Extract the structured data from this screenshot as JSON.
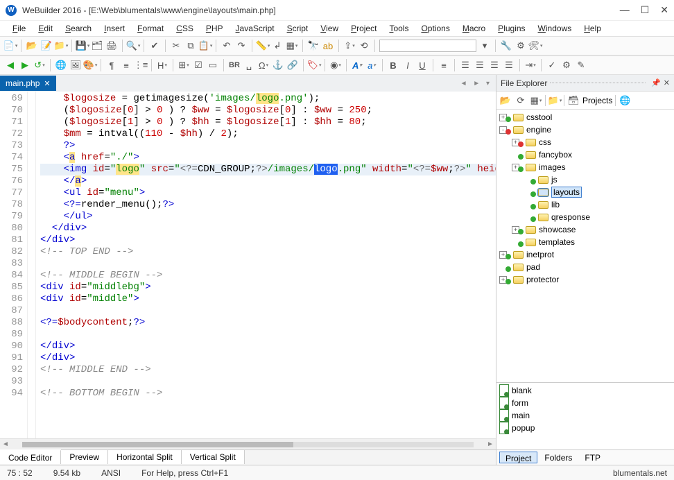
{
  "window": {
    "title": "WeBuilder 2016 - [E:\\Web\\blumentals\\www\\engine\\layouts\\main.php]",
    "app_initial": "W"
  },
  "menu": [
    "File",
    "Edit",
    "Search",
    "Insert",
    "Format",
    "CSS",
    "PHP",
    "JavaScript",
    "Script",
    "View",
    "Project",
    "Tools",
    "Options",
    "Macro",
    "Plugins",
    "Windows",
    "Help"
  ],
  "tabs": {
    "file": "main.php"
  },
  "code": {
    "start": 69,
    "lines": [
      {
        "n": 69,
        "seg": [
          {
            "t": "    ",
            "c": ""
          },
          {
            "t": "$logosize",
            "c": "c-var"
          },
          {
            "t": " = getimagesize(",
            "c": ""
          },
          {
            "t": "'images/",
            "c": "c-str"
          },
          {
            "t": "logo",
            "c": "c-str hl-y"
          },
          {
            "t": ".png'",
            "c": "c-str"
          },
          {
            "t": ");",
            "c": ""
          }
        ]
      },
      {
        "n": 70,
        "seg": [
          {
            "t": "    (",
            "c": ""
          },
          {
            "t": "$logosize",
            "c": "c-var"
          },
          {
            "t": "[",
            "c": ""
          },
          {
            "t": "0",
            "c": "c-num"
          },
          {
            "t": "] > ",
            "c": ""
          },
          {
            "t": "0",
            "c": "c-num"
          },
          {
            "t": " ) ? ",
            "c": ""
          },
          {
            "t": "$ww",
            "c": "c-var"
          },
          {
            "t": " = ",
            "c": ""
          },
          {
            "t": "$logosize",
            "c": "c-var"
          },
          {
            "t": "[",
            "c": ""
          },
          {
            "t": "0",
            "c": "c-num"
          },
          {
            "t": "] : ",
            "c": ""
          },
          {
            "t": "$ww",
            "c": "c-var"
          },
          {
            "t": " = ",
            "c": ""
          },
          {
            "t": "250",
            "c": "c-num"
          },
          {
            "t": ";",
            "c": ""
          }
        ]
      },
      {
        "n": 71,
        "seg": [
          {
            "t": "    (",
            "c": ""
          },
          {
            "t": "$logosize",
            "c": "c-var"
          },
          {
            "t": "[",
            "c": ""
          },
          {
            "t": "1",
            "c": "c-num"
          },
          {
            "t": "] > ",
            "c": ""
          },
          {
            "t": "0",
            "c": "c-num"
          },
          {
            "t": " ) ? ",
            "c": ""
          },
          {
            "t": "$hh",
            "c": "c-var"
          },
          {
            "t": " = ",
            "c": ""
          },
          {
            "t": "$logosize",
            "c": "c-var"
          },
          {
            "t": "[",
            "c": ""
          },
          {
            "t": "1",
            "c": "c-num"
          },
          {
            "t": "] : ",
            "c": ""
          },
          {
            "t": "$hh",
            "c": "c-var"
          },
          {
            "t": " = ",
            "c": ""
          },
          {
            "t": "80",
            "c": "c-num"
          },
          {
            "t": ";",
            "c": ""
          }
        ]
      },
      {
        "n": 72,
        "seg": [
          {
            "t": "    ",
            "c": ""
          },
          {
            "t": "$mm",
            "c": "c-var"
          },
          {
            "t": " = intval((",
            "c": ""
          },
          {
            "t": "110",
            "c": "c-num"
          },
          {
            "t": " - ",
            "c": ""
          },
          {
            "t": "$hh",
            "c": "c-var"
          },
          {
            "t": ") / ",
            "c": ""
          },
          {
            "t": "2",
            "c": "c-num"
          },
          {
            "t": ");",
            "c": ""
          }
        ]
      },
      {
        "n": 73,
        "seg": [
          {
            "t": "    ",
            "c": ""
          },
          {
            "t": "?>",
            "c": "c-kw"
          }
        ]
      },
      {
        "n": 74,
        "seg": [
          {
            "t": "    <",
            "c": "c-tag"
          },
          {
            "t": "a",
            "c": "c-tag hl-y"
          },
          {
            "t": " ",
            "c": ""
          },
          {
            "t": "href",
            "c": "c-attr"
          },
          {
            "t": "=",
            "c": ""
          },
          {
            "t": "\"./\"",
            "c": "c-str"
          },
          {
            "t": ">",
            "c": "c-tag"
          }
        ]
      },
      {
        "n": 75,
        "hl": true,
        "seg": [
          {
            "t": "    <",
            "c": "c-tag"
          },
          {
            "t": "img",
            "c": "c-tag"
          },
          {
            "t": " ",
            "c": ""
          },
          {
            "t": "id",
            "c": "c-attr"
          },
          {
            "t": "=",
            "c": ""
          },
          {
            "t": "\"",
            "c": "c-str"
          },
          {
            "t": "logo",
            "c": "c-str hl-y"
          },
          {
            "t": "\"",
            "c": "c-str"
          },
          {
            "t": " ",
            "c": ""
          },
          {
            "t": "src",
            "c": "c-attr"
          },
          {
            "t": "=",
            "c": ""
          },
          {
            "t": "\"",
            "c": "c-str"
          },
          {
            "t": "<?=",
            "c": "c-php"
          },
          {
            "t": "CDN_GROUP",
            "c": ""
          },
          {
            "t": ";",
            "c": ""
          },
          {
            "t": "?>",
            "c": "c-php"
          },
          {
            "t": "/images/",
            "c": "c-str"
          },
          {
            "t": "logo",
            "c": "hl-b"
          },
          {
            "t": ".png\"",
            "c": "c-str"
          },
          {
            "t": " ",
            "c": ""
          },
          {
            "t": "width",
            "c": "c-attr"
          },
          {
            "t": "=",
            "c": ""
          },
          {
            "t": "\"",
            "c": "c-str"
          },
          {
            "t": "<?=",
            "c": "c-php"
          },
          {
            "t": "$ww",
            "c": "c-var"
          },
          {
            "t": ";",
            "c": ""
          },
          {
            "t": "?>",
            "c": "c-php"
          },
          {
            "t": "\"",
            "c": "c-str"
          },
          {
            "t": " heigh",
            "c": "c-attr"
          }
        ]
      },
      {
        "n": 76,
        "seg": [
          {
            "t": "    </",
            "c": "c-tag"
          },
          {
            "t": "a",
            "c": "c-tag hl-y"
          },
          {
            "t": ">",
            "c": "c-tag"
          }
        ]
      },
      {
        "n": 77,
        "seg": [
          {
            "t": "    <",
            "c": "c-tag"
          },
          {
            "t": "ul",
            "c": "c-tag"
          },
          {
            "t": " ",
            "c": ""
          },
          {
            "t": "id",
            "c": "c-attr"
          },
          {
            "t": "=",
            "c": ""
          },
          {
            "t": "\"menu\"",
            "c": "c-str"
          },
          {
            "t": ">",
            "c": "c-tag"
          }
        ]
      },
      {
        "n": 78,
        "seg": [
          {
            "t": "    ",
            "c": ""
          },
          {
            "t": "<?=",
            "c": "c-kw"
          },
          {
            "t": "render_menu();",
            "c": ""
          },
          {
            "t": "?>",
            "c": "c-kw"
          }
        ]
      },
      {
        "n": 79,
        "seg": [
          {
            "t": "    </",
            "c": "c-tag"
          },
          {
            "t": "ul",
            "c": "c-tag"
          },
          {
            "t": ">",
            "c": "c-tag"
          }
        ]
      },
      {
        "n": 80,
        "seg": [
          {
            "t": "  </",
            "c": "c-tag"
          },
          {
            "t": "div",
            "c": "c-tag"
          },
          {
            "t": ">",
            "c": "c-tag"
          }
        ]
      },
      {
        "n": 81,
        "seg": [
          {
            "t": "</",
            "c": "c-tag"
          },
          {
            "t": "div",
            "c": "c-tag"
          },
          {
            "t": ">",
            "c": "c-tag"
          }
        ]
      },
      {
        "n": 82,
        "seg": [
          {
            "t": "<!-- TOP END -->",
            "c": "c-cmt"
          }
        ]
      },
      {
        "n": 83,
        "seg": [
          {
            "t": "",
            "c": ""
          }
        ]
      },
      {
        "n": 84,
        "seg": [
          {
            "t": "<!-- MIDDLE BEGIN -->",
            "c": "c-cmt"
          }
        ]
      },
      {
        "n": 85,
        "seg": [
          {
            "t": "<",
            "c": "c-tag"
          },
          {
            "t": "div",
            "c": "c-tag"
          },
          {
            "t": " ",
            "c": ""
          },
          {
            "t": "id",
            "c": "c-attr"
          },
          {
            "t": "=",
            "c": ""
          },
          {
            "t": "\"middlebg\"",
            "c": "c-str"
          },
          {
            "t": ">",
            "c": "c-tag"
          }
        ]
      },
      {
        "n": 86,
        "seg": [
          {
            "t": "<",
            "c": "c-tag"
          },
          {
            "t": "div",
            "c": "c-tag"
          },
          {
            "t": " ",
            "c": ""
          },
          {
            "t": "id",
            "c": "c-attr"
          },
          {
            "t": "=",
            "c": ""
          },
          {
            "t": "\"middle\"",
            "c": "c-str"
          },
          {
            "t": ">",
            "c": "c-tag"
          }
        ]
      },
      {
        "n": 87,
        "seg": [
          {
            "t": "",
            "c": ""
          }
        ]
      },
      {
        "n": 88,
        "seg": [
          {
            "t": "<?=",
            "c": "c-kw"
          },
          {
            "t": "$bodycontent",
            "c": "c-var"
          },
          {
            "t": ";",
            "c": ""
          },
          {
            "t": "?>",
            "c": "c-kw"
          }
        ]
      },
      {
        "n": 89,
        "seg": [
          {
            "t": "",
            "c": ""
          }
        ]
      },
      {
        "n": 90,
        "seg": [
          {
            "t": "</",
            "c": "c-tag"
          },
          {
            "t": "div",
            "c": "c-tag"
          },
          {
            "t": ">",
            "c": "c-tag"
          }
        ]
      },
      {
        "n": 91,
        "seg": [
          {
            "t": "</",
            "c": "c-tag"
          },
          {
            "t": "div",
            "c": "c-tag"
          },
          {
            "t": ">",
            "c": "c-tag"
          }
        ]
      },
      {
        "n": 92,
        "seg": [
          {
            "t": "<!-- MIDDLE END -->",
            "c": "c-cmt"
          }
        ]
      },
      {
        "n": 93,
        "seg": [
          {
            "t": "",
            "c": ""
          }
        ]
      },
      {
        "n": 94,
        "seg": [
          {
            "t": "<!-- BOTTOM BEGIN -->",
            "c": "c-cmt"
          }
        ]
      }
    ]
  },
  "bottom_tabs": [
    "Code Editor",
    "Preview",
    "Horizontal Split",
    "Vertical Split"
  ],
  "explorer": {
    "title": "File Explorer",
    "projects_label": "Projects",
    "tree": [
      {
        "depth": 0,
        "exp": "+",
        "badge": "g",
        "label": "csstool"
      },
      {
        "depth": 0,
        "exp": "-",
        "badge": "r",
        "label": "engine"
      },
      {
        "depth": 1,
        "exp": "+",
        "badge": "r",
        "label": "css"
      },
      {
        "depth": 1,
        "exp": "",
        "badge": "g",
        "label": "fancybox"
      },
      {
        "depth": 1,
        "exp": "+",
        "badge": "g",
        "label": "images"
      },
      {
        "depth": 2,
        "exp": "",
        "badge": "g",
        "label": "js"
      },
      {
        "depth": 2,
        "exp": "",
        "badge": "g",
        "label": "layouts",
        "sel": true
      },
      {
        "depth": 2,
        "exp": "",
        "badge": "g",
        "label": "lib"
      },
      {
        "depth": 2,
        "exp": "",
        "badge": "g",
        "label": "qresponse"
      },
      {
        "depth": 1,
        "exp": "+",
        "badge": "g",
        "label": "showcase"
      },
      {
        "depth": 1,
        "exp": "",
        "badge": "g",
        "label": "templates"
      },
      {
        "depth": 0,
        "exp": "+",
        "badge": "g",
        "label": "inetprot"
      },
      {
        "depth": 0,
        "exp": "",
        "badge": "g",
        "label": "pad"
      },
      {
        "depth": 0,
        "exp": "+",
        "badge": "g",
        "label": "protector"
      }
    ],
    "files": [
      "blank",
      "form",
      "main",
      "popup"
    ],
    "bottom_tabs": [
      "Project",
      "Folders",
      "FTP"
    ]
  },
  "status": {
    "pos": "75 : 52",
    "size": "9.54 kb",
    "enc": "ANSI",
    "help": "For Help, press Ctrl+F1",
    "brand": "blumentals.net"
  }
}
